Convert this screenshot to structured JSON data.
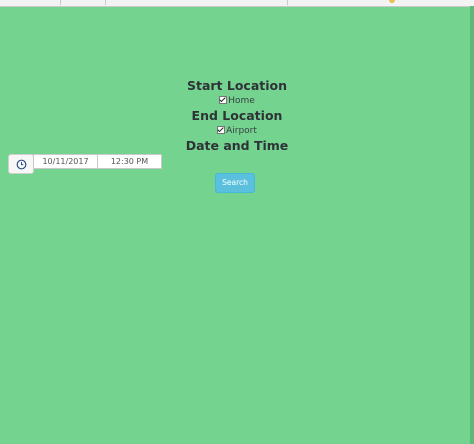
{
  "form": {
    "start_location_heading": "Start Location",
    "start_checkbox_label": "Home",
    "end_location_heading": "End Location",
    "end_checkbox_label": "Airport",
    "date_time_heading": "Date and Time",
    "date_value": "10/11/2017",
    "time_value": "12:30 PM",
    "search_label": "Search"
  },
  "icons": {
    "clock_button_icon": "clock-icon"
  },
  "colors": {
    "background": "#74d38e",
    "search_button": "#5bc0de"
  }
}
